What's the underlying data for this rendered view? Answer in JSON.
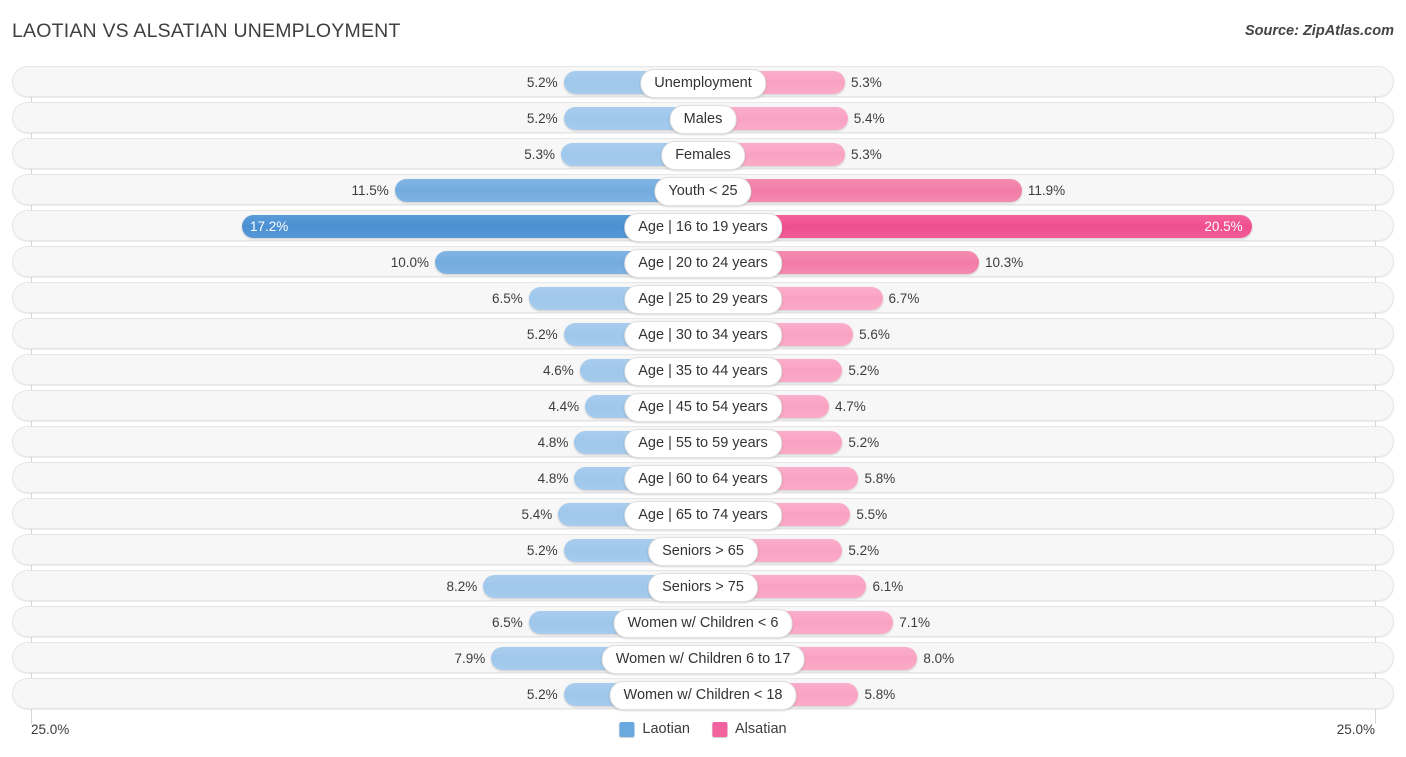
{
  "header": {
    "title": "LAOTIAN VS ALSATIAN UNEMPLOYMENT",
    "source": "Source: ZipAtlas.com"
  },
  "axis": {
    "min_label": "25.0%",
    "max_label": "25.0%",
    "max_value": 25.0
  },
  "legend": {
    "items": [
      {
        "label": "Laotian",
        "color": "#6aa9e0"
      },
      {
        "label": "Alsatian",
        "color": "#f2629f"
      }
    ]
  },
  "colors": {
    "left_base": "#9ec7eb",
    "left_high": "#74ace0",
    "left_max": "#4b90d3",
    "right_base": "#f9a2c2",
    "right_high": "#f27da7",
    "right_max": "#ef4f8f",
    "track": "#f7f7f7",
    "gridline": "#d8d8dc"
  },
  "chart_data": {
    "type": "bar",
    "title": "LAOTIAN VS ALSATIAN UNEMPLOYMENT",
    "subtitle": "",
    "xlabel": "",
    "ylabel": "",
    "orientation": "horizontal",
    "style": "diverging-bidirectional",
    "xlim": [
      25.0,
      25.0
    ],
    "grid": true,
    "legend_position": "bottom-center",
    "categories": [
      "Unemployment",
      "Males",
      "Females",
      "Youth < 25",
      "Age | 16 to 19 years",
      "Age | 20 to 24 years",
      "Age | 25 to 29 years",
      "Age | 30 to 34 years",
      "Age | 35 to 44 years",
      "Age | 45 to 54 years",
      "Age | 55 to 59 years",
      "Age | 60 to 64 years",
      "Age | 65 to 74 years",
      "Seniors > 65",
      "Seniors > 75",
      "Women w/ Children < 6",
      "Women w/ Children 6 to 17",
      "Women w/ Children < 18"
    ],
    "series": [
      {
        "name": "Laotian",
        "color": "#6aa9e0",
        "side": "left",
        "values": [
          5.2,
          5.2,
          5.3,
          11.5,
          17.2,
          10.0,
          6.5,
          5.2,
          4.6,
          4.4,
          4.8,
          4.8,
          5.4,
          5.2,
          8.2,
          6.5,
          7.9,
          5.2
        ],
        "labels": [
          "5.2%",
          "5.2%",
          "5.3%",
          "11.5%",
          "17.2%",
          "10.0%",
          "6.5%",
          "5.2%",
          "4.6%",
          "4.4%",
          "4.8%",
          "4.8%",
          "5.4%",
          "5.2%",
          "8.2%",
          "6.5%",
          "7.9%",
          "5.2%"
        ]
      },
      {
        "name": "Alsatian",
        "color": "#f2629f",
        "side": "right",
        "values": [
          5.3,
          5.4,
          5.3,
          11.9,
          20.5,
          10.3,
          6.7,
          5.6,
          5.2,
          4.7,
          5.2,
          5.8,
          5.5,
          5.2,
          6.1,
          7.1,
          8.0,
          5.8
        ],
        "labels": [
          "5.3%",
          "5.4%",
          "5.3%",
          "11.9%",
          "20.5%",
          "10.3%",
          "6.7%",
          "5.6%",
          "5.2%",
          "4.7%",
          "5.2%",
          "5.8%",
          "5.5%",
          "5.2%",
          "6.1%",
          "7.1%",
          "8.0%",
          "5.8%"
        ]
      }
    ]
  }
}
